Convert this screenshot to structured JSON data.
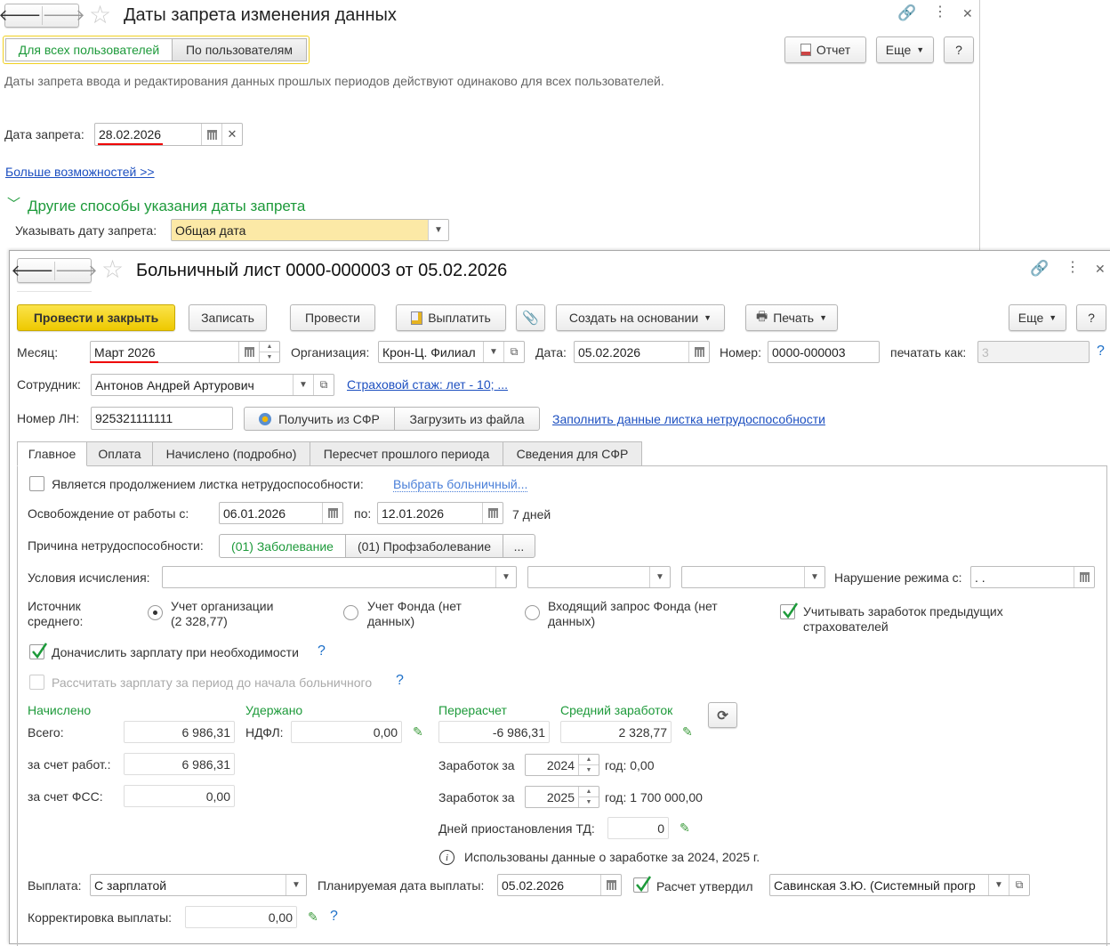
{
  "back_window": {
    "title": "Даты запрета изменения данных",
    "toggle": {
      "all_users": "Для всех пользователей",
      "by_users": "По пользователям"
    },
    "report_label": "Отчет",
    "more_label": "Еще",
    "help_label": "?",
    "info_text": "Даты запрета ввода и редактирования данных прошлых периодов действуют одинаково для всех пользователей.",
    "date_label": "Дата запрета:",
    "date_value": "28.02.2026",
    "more_link": "Больше возможностей >>",
    "section_title": "Другие способы указания даты запрета",
    "mode_label": "Указывать дату запрета:",
    "mode_value": "Общая дата"
  },
  "doc": {
    "title": "Больничный лист 0000-000003 от 05.02.2026",
    "toolbar": {
      "post_close": "Провести и закрыть",
      "save": "Записать",
      "post": "Провести",
      "pay": "Выплатить",
      "create_based": "Создать на основании",
      "print": "Печать",
      "more": "Еще",
      "help": "?"
    },
    "header": {
      "month_label": "Месяц:",
      "month_value": "Март 2026",
      "org_label": "Организация:",
      "org_value": "Крон-Ц. Филиал",
      "date_label": "Дата:",
      "date_value": "05.02.2026",
      "number_label": "Номер:",
      "number_value": "0000-000003",
      "print_as_label": "печатать как:",
      "print_as_value": "3",
      "help": "?",
      "employee_label": "Сотрудник:",
      "employee_value": "Антонов Андрей Артурович",
      "insurance_link": "Страховой стаж: лет - 10; ...",
      "ln_label": "Номер ЛН:",
      "ln_value": "925321111111",
      "get_sfr": "Получить из СФР",
      "load_file": "Загрузить из файла",
      "fill_link": "Заполнить данные листка нетрудоспособности"
    },
    "tabs": [
      "Главное",
      "Оплата",
      "Начислено (подробно)",
      "Пересчет прошлого периода",
      "Сведения для СФР"
    ],
    "main": {
      "continuation_label": "Является продолжением листка нетрудоспособности:",
      "choose_link": "Выбрать больничный...",
      "release_label": "Освобождение от работы с:",
      "release_from": "06.01.2026",
      "to_label": "по:",
      "release_to": "12.01.2026",
      "days": "7 дней",
      "reason_label": "Причина нетрудоспособности:",
      "reason_options": [
        "(01) Заболевание",
        "(01) Профзаболевание",
        "..."
      ],
      "conditions_label": "Условия исчисления:",
      "violation_label": "Нарушение режима с:",
      "violation_value": " .  .",
      "source_label_1": "Источник",
      "source_label_2": "среднего:",
      "source_options": [
        {
          "line1": "Учет организации",
          "line2": "(2 328,77)",
          "selected": true
        },
        {
          "line1": "Учет Фонда (нет",
          "line2": "данных)",
          "selected": false
        },
        {
          "line1": "Входящий запрос Фонда (нет",
          "line2": "данных)",
          "selected": false
        }
      ],
      "prev_employers_1": "Учитывать заработок предыдущих",
      "prev_employers_2": "страхователей",
      "accrue_salary": "Доначислить зарплату при необходимости",
      "calc_salary_before": "Рассчитать зарплату за период до начала больничного",
      "help": "?",
      "accrued_header": "Начислено",
      "withheld_header": "Удержано",
      "recalc_header": "Перерасчет",
      "avg_header": "Средний заработок",
      "total_label": "Всего:",
      "total_value": "6 986,31",
      "ndfl_label": "НДФЛ:",
      "ndfl_value": "0,00",
      "recalc_value": "-6 986,31",
      "avg_value": "2 328,77",
      "employer_label": "за счет работ.:",
      "employer_value": "6 986,31",
      "fss_label": "за счет ФСС:",
      "fss_value": "0,00",
      "earnings_label": "Заработок за",
      "year1": "2024",
      "year1_text": "год:  0,00",
      "year2": "2025",
      "year2_text": "год:  1 700 000,00",
      "suspension_label": "Дней приостановления ТД:",
      "suspension_value": "0",
      "info_text": "Использованы данные о заработке за  2024,  2025 г.",
      "payment_label": "Выплата:",
      "payment_value": "С зарплатой",
      "planned_date_label": "Планируемая дата выплаты:",
      "planned_date_value": "05.02.2026",
      "approved_label": "Расчет утвердил",
      "approved_value": "Савинская З.Ю. (Системный прогр",
      "correction_label": "Корректировка выплаты:",
      "correction_value": "0,00"
    }
  },
  "colors": {
    "accent_yellow": "#f5d10a",
    "green": "#1d9a3a",
    "link": "#1c4fc0",
    "highlight": "#fce9a6"
  }
}
